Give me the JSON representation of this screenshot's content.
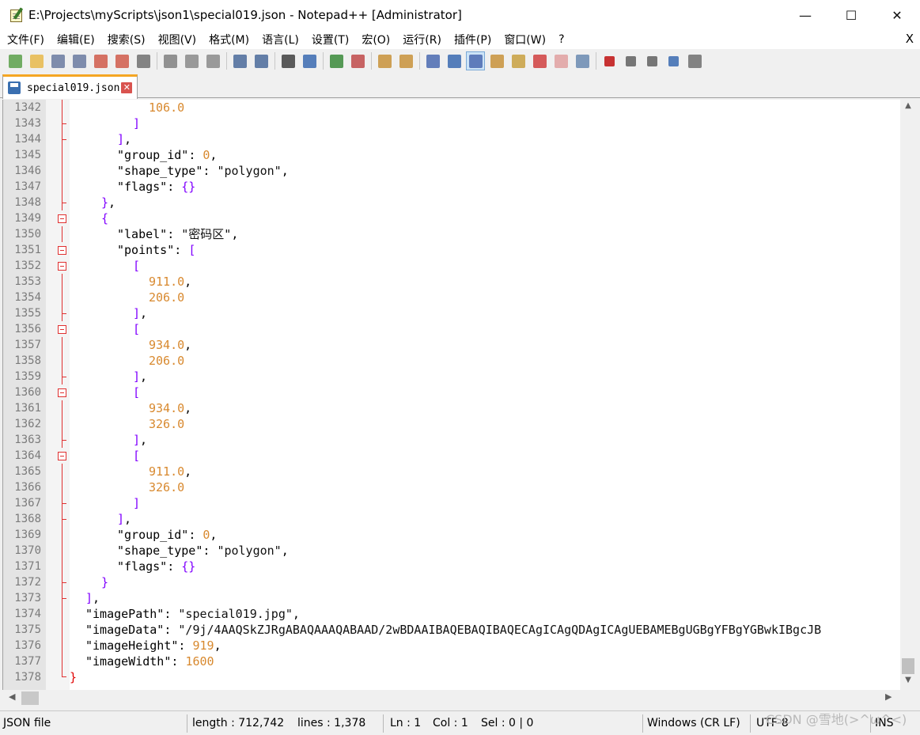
{
  "window": {
    "title": "E:\\Projects\\myScripts\\json1\\special019.json - Notepad++ [Administrator]",
    "controls": {
      "minimize": "—",
      "maximize": "☐",
      "close": "✕"
    }
  },
  "menu": {
    "items": [
      "文件(F)",
      "编辑(E)",
      "搜索(S)",
      "视图(V)",
      "格式(M)",
      "语言(L)",
      "设置(T)",
      "宏(O)",
      "运行(R)",
      "插件(P)",
      "窗口(W)",
      "?"
    ],
    "close_label": "X"
  },
  "toolbar": {
    "icons": [
      "new-file-icon",
      "open-file-icon",
      "save-icon",
      "save-all-icon",
      "close-icon",
      "close-all-icon",
      "print-icon",
      "cut-icon",
      "copy-icon",
      "paste-icon",
      "undo-icon",
      "redo-icon",
      "find-icon",
      "replace-icon",
      "zoom-in-icon",
      "zoom-out-icon",
      "sync-vertical-icon",
      "sync-horizontal-icon",
      "word-wrap-icon",
      "show-all-chars-icon",
      "indent-guide-icon",
      "document-map-icon",
      "function-list-icon",
      "folder-workspace-icon",
      "folder-icon",
      "monitoring-icon",
      "record-macro-icon",
      "stop-macro-icon",
      "play-macro-icon",
      "run-macro-multiple-icon",
      "save-macro-icon"
    ]
  },
  "tab": {
    "label": "special019.json",
    "close": "✕"
  },
  "editor": {
    "lines": [
      {
        "n": "1342",
        "indent": 5,
        "tokens": [
          [
            "n",
            "106.0"
          ]
        ]
      },
      {
        "n": "1343",
        "indent": 4,
        "tokens": [
          [
            "p",
            "]"
          ]
        ]
      },
      {
        "n": "1344",
        "indent": 3,
        "tokens": [
          [
            "p",
            "]"
          ],
          [
            "o",
            ","
          ]
        ]
      },
      {
        "n": "1345",
        "indent": 3,
        "tokens": [
          [
            "k",
            "\"group_id\""
          ],
          [
            "o",
            ": "
          ],
          [
            "n",
            "0"
          ],
          [
            "o",
            ","
          ]
        ]
      },
      {
        "n": "1346",
        "indent": 3,
        "tokens": [
          [
            "k",
            "\"shape_type\""
          ],
          [
            "o",
            ": "
          ],
          [
            "s",
            "\"polygon\""
          ],
          [
            "o",
            ","
          ]
        ]
      },
      {
        "n": "1347",
        "indent": 3,
        "tokens": [
          [
            "k",
            "\"flags\""
          ],
          [
            "o",
            ": "
          ],
          [
            "p",
            "{}"
          ]
        ]
      },
      {
        "n": "1348",
        "indent": 2,
        "tokens": [
          [
            "p",
            "}"
          ],
          [
            "o",
            ","
          ]
        ]
      },
      {
        "n": "1349",
        "indent": 2,
        "tokens": [
          [
            "p",
            "{"
          ]
        ]
      },
      {
        "n": "1350",
        "indent": 3,
        "tokens": [
          [
            "k",
            "\"label\""
          ],
          [
            "o",
            ": "
          ],
          [
            "s",
            "\"密码区\""
          ],
          [
            "o",
            ","
          ]
        ]
      },
      {
        "n": "1351",
        "indent": 3,
        "tokens": [
          [
            "k",
            "\"points\""
          ],
          [
            "o",
            ": "
          ],
          [
            "p",
            "["
          ]
        ]
      },
      {
        "n": "1352",
        "indent": 4,
        "tokens": [
          [
            "p",
            "["
          ]
        ]
      },
      {
        "n": "1353",
        "indent": 5,
        "tokens": [
          [
            "n",
            "911.0"
          ],
          [
            "o",
            ","
          ]
        ]
      },
      {
        "n": "1354",
        "indent": 5,
        "tokens": [
          [
            "n",
            "206.0"
          ]
        ]
      },
      {
        "n": "1355",
        "indent": 4,
        "tokens": [
          [
            "p",
            "]"
          ],
          [
            "o",
            ","
          ]
        ]
      },
      {
        "n": "1356",
        "indent": 4,
        "tokens": [
          [
            "p",
            "["
          ]
        ]
      },
      {
        "n": "1357",
        "indent": 5,
        "tokens": [
          [
            "n",
            "934.0"
          ],
          [
            "o",
            ","
          ]
        ]
      },
      {
        "n": "1358",
        "indent": 5,
        "tokens": [
          [
            "n",
            "206.0"
          ]
        ]
      },
      {
        "n": "1359",
        "indent": 4,
        "tokens": [
          [
            "p",
            "]"
          ],
          [
            "o",
            ","
          ]
        ]
      },
      {
        "n": "1360",
        "indent": 4,
        "tokens": [
          [
            "p",
            "["
          ]
        ]
      },
      {
        "n": "1361",
        "indent": 5,
        "tokens": [
          [
            "n",
            "934.0"
          ],
          [
            "o",
            ","
          ]
        ]
      },
      {
        "n": "1362",
        "indent": 5,
        "tokens": [
          [
            "n",
            "326.0"
          ]
        ]
      },
      {
        "n": "1363",
        "indent": 4,
        "tokens": [
          [
            "p",
            "]"
          ],
          [
            "o",
            ","
          ]
        ]
      },
      {
        "n": "1364",
        "indent": 4,
        "tokens": [
          [
            "p",
            "["
          ]
        ]
      },
      {
        "n": "1365",
        "indent": 5,
        "tokens": [
          [
            "n",
            "911.0"
          ],
          [
            "o",
            ","
          ]
        ]
      },
      {
        "n": "1366",
        "indent": 5,
        "tokens": [
          [
            "n",
            "326.0"
          ]
        ]
      },
      {
        "n": "1367",
        "indent": 4,
        "tokens": [
          [
            "p",
            "]"
          ]
        ]
      },
      {
        "n": "1368",
        "indent": 3,
        "tokens": [
          [
            "p",
            "]"
          ],
          [
            "o",
            ","
          ]
        ]
      },
      {
        "n": "1369",
        "indent": 3,
        "tokens": [
          [
            "k",
            "\"group_id\""
          ],
          [
            "o",
            ": "
          ],
          [
            "n",
            "0"
          ],
          [
            "o",
            ","
          ]
        ]
      },
      {
        "n": "1370",
        "indent": 3,
        "tokens": [
          [
            "k",
            "\"shape_type\""
          ],
          [
            "o",
            ": "
          ],
          [
            "s",
            "\"polygon\""
          ],
          [
            "o",
            ","
          ]
        ]
      },
      {
        "n": "1371",
        "indent": 3,
        "tokens": [
          [
            "k",
            "\"flags\""
          ],
          [
            "o",
            ": "
          ],
          [
            "p",
            "{}"
          ]
        ]
      },
      {
        "n": "1372",
        "indent": 2,
        "tokens": [
          [
            "p",
            "}"
          ]
        ]
      },
      {
        "n": "1373",
        "indent": 1,
        "tokens": [
          [
            "p",
            "]"
          ],
          [
            "o",
            ","
          ]
        ]
      },
      {
        "n": "1374",
        "indent": 1,
        "tokens": [
          [
            "k",
            "\"imagePath\""
          ],
          [
            "o",
            ": "
          ],
          [
            "s",
            "\"special019.jpg\""
          ],
          [
            "o",
            ","
          ]
        ]
      },
      {
        "n": "1375",
        "indent": 1,
        "tokens": [
          [
            "k",
            "\"imageData\""
          ],
          [
            "o",
            ": "
          ],
          [
            "s",
            "\"/9j/4AAQSkZJRgABAQAAAQABAAD/2wBDAAIBAQEBAQIBAQECAgICAgQDAgICAgUEBAMEBgUGBgYFBgYGBwkIBgcJB"
          ]
        ]
      },
      {
        "n": "1376",
        "indent": 1,
        "tokens": [
          [
            "k",
            "\"imageHeight\""
          ],
          [
            "o",
            ": "
          ],
          [
            "n",
            "919"
          ],
          [
            "o",
            ","
          ]
        ]
      },
      {
        "n": "1377",
        "indent": 1,
        "tokens": [
          [
            "k",
            "\"imageWidth\""
          ],
          [
            "o",
            ": "
          ],
          [
            "n",
            "1600"
          ]
        ]
      },
      {
        "n": "1378",
        "indent": 0,
        "tokens": [
          [
            "r",
            "}"
          ]
        ]
      }
    ],
    "fold_boxes": [
      "1349",
      "1351",
      "1352",
      "1356",
      "1360",
      "1364"
    ],
    "fold_end": "1378"
  },
  "status": {
    "file_type": "JSON file",
    "length": "length : 712,742",
    "lines": "lines : 1,378",
    "ln": "Ln : 1",
    "col": "Col : 1",
    "sel": "Sel : 0 | 0",
    "eol": "Windows (CR LF)",
    "encoding": "UTF-8",
    "mode": "INS"
  },
  "watermark": "CSDN @雪地(>^ω^<)",
  "colors": {
    "key": "#000000",
    "number": "#d8892f",
    "bracket": "#8000ff",
    "root_brace": "#e00000",
    "fold": "#e03030",
    "tab_accent": "#f5a623"
  }
}
